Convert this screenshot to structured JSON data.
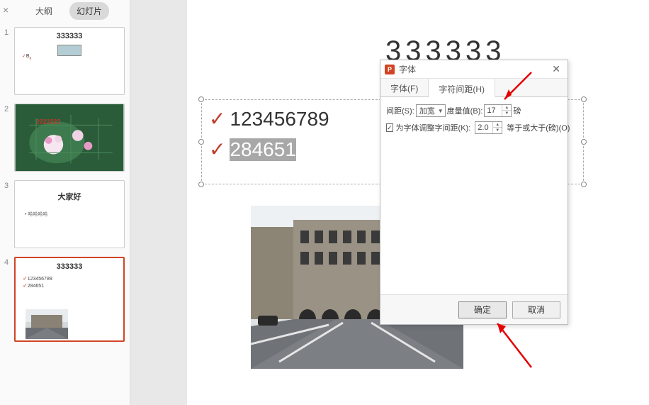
{
  "sidebar": {
    "tab_outline": "大纲",
    "tab_slides": "幻灯片",
    "thumbs": [
      {
        "num": "1",
        "title": "333333",
        "sub_b": "B",
        "rect": true
      },
      {
        "num": "2",
        "title_overlay": "2222222",
        "photo": "flower"
      },
      {
        "num": "3",
        "title": "大家好",
        "bullets": [
          "哈哈哈哈"
        ]
      },
      {
        "num": "4",
        "title": "333333",
        "bullets": [
          "123456789",
          "284651"
        ],
        "img": "street",
        "selected": true
      }
    ]
  },
  "slide": {
    "title": "333333",
    "lines": [
      {
        "text": "123456789",
        "selected": false
      },
      {
        "text": "284651",
        "selected": true
      }
    ]
  },
  "dialog": {
    "title": "字体",
    "tabs": {
      "font": "字体(F)",
      "spacing": "字符间距(H)"
    },
    "spacing_label": "间距(S):",
    "spacing_value": "加宽",
    "measure_label": "度量值(B):",
    "measure_value": "17",
    "measure_unit": "磅",
    "kern_label": "为字体调整字间距(K):",
    "kern_value": "2.0",
    "kern_suffix": "等于或大于(磅)(O)",
    "kern_checked": "✓",
    "ok": "确定",
    "cancel": "取消"
  }
}
